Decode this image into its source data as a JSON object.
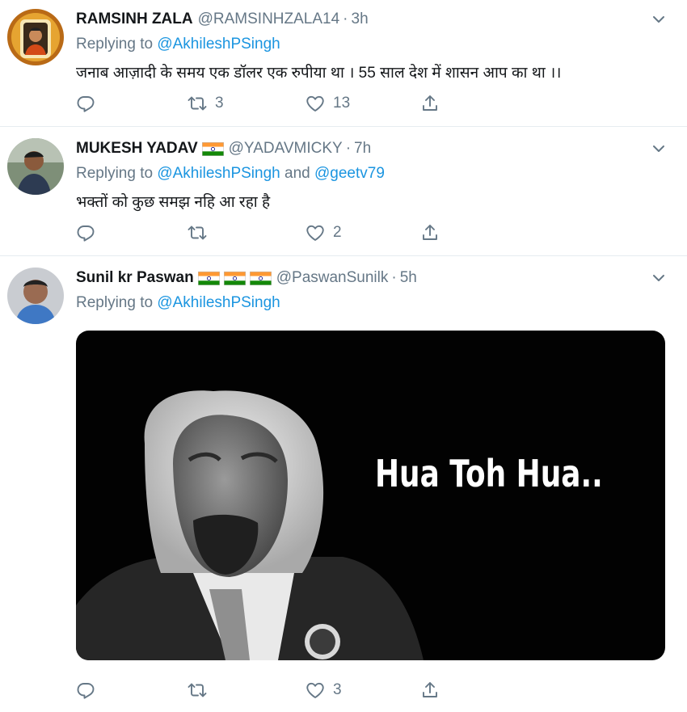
{
  "tweets": [
    {
      "name": "RAMSINH ZALA",
      "handle": "@RAMSINHZALA14",
      "time": "3h",
      "replying_prefix": "Replying to ",
      "replying_to": "@AkhileshPSingh",
      "text": "जनाब आज़ादी के समय एक डॉलर एक रुपीया था । 55 साल देश में शासन आप का था ।।",
      "reply_count": "",
      "retweet_count": "3",
      "like_count": "13"
    },
    {
      "name": "MUKESH YADAV",
      "handle": "@YADAVMICKY",
      "time": "7h",
      "replying_prefix": "Replying to ",
      "replying_to": "@AkhileshPSingh",
      "replying_and": " and ",
      "replying_to_2": "@geetv79",
      "text": "भक्तों को कुछ समझ नहि आ रहा है",
      "reply_count": "",
      "retweet_count": "",
      "like_count": "2"
    },
    {
      "name": "Sunil kr Paswan",
      "handle": "@PaswanSunilk",
      "time": "5h",
      "replying_prefix": "Replying to ",
      "replying_to": "@AkhileshPSingh",
      "media_text": "Hua Toh Hua..",
      "reply_count": "",
      "retweet_count": "",
      "like_count": "3"
    }
  ],
  "separator": "·",
  "icons": [
    "reply-icon",
    "retweet-icon",
    "like-icon",
    "share-icon",
    "chevron-down-icon",
    "india-flag-icon"
  ],
  "colors": {
    "link": "#1b95e0",
    "muted": "#657786",
    "text": "#14171a",
    "divider": "#e6ecf0"
  }
}
